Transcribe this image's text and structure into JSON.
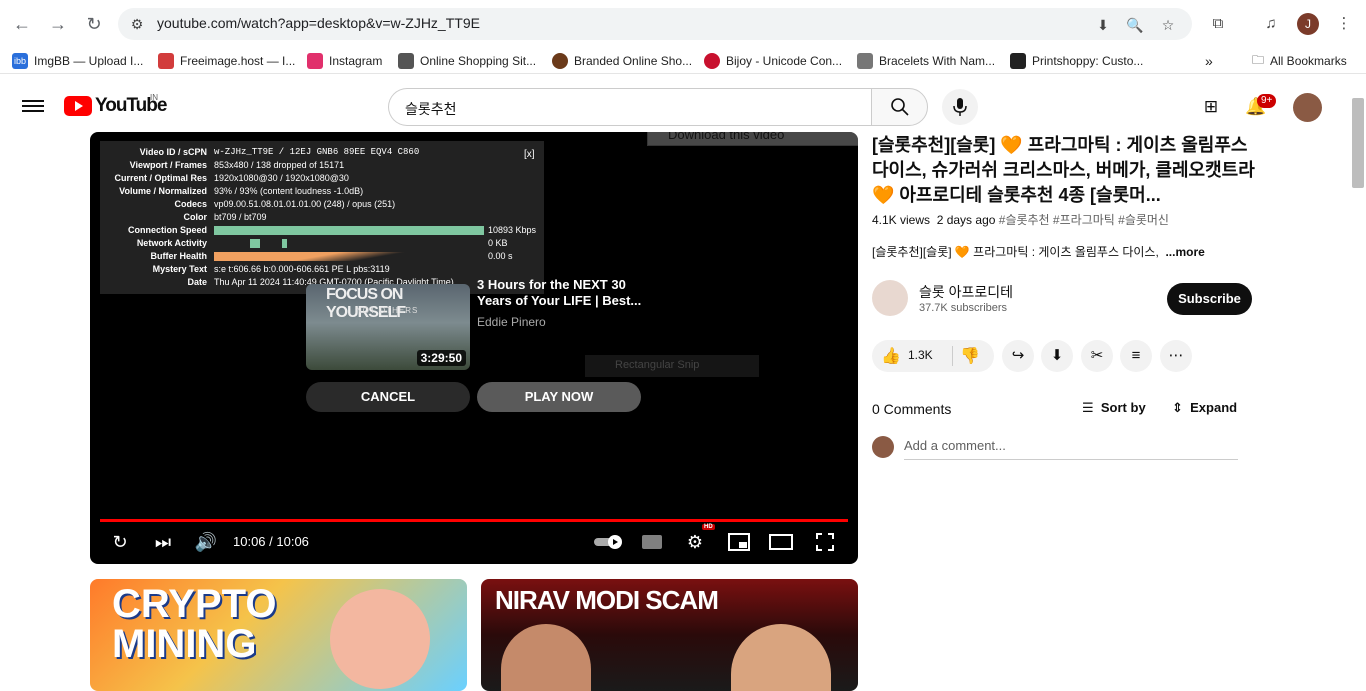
{
  "browser": {
    "url": "youtube.com/watch?app=desktop&v=w-ZJHz_TT9E",
    "profile_initial": "J",
    "bookmarks": [
      {
        "label": "ImgBB — Upload I...",
        "icon_color": "#2a6fdb"
      },
      {
        "label": "Freeimage.host — I...",
        "icon_color": "#d23c3c"
      },
      {
        "label": "Instagram",
        "icon_color": "#e1306c"
      },
      {
        "label": "Online Shopping Sit...",
        "icon_color": "#555555"
      },
      {
        "label": "Branded Online Sho...",
        "icon_color": "#6b3a1a"
      },
      {
        "label": "Bijoy - Unicode Con...",
        "icon_color": "#c8102e"
      },
      {
        "label": "Bracelets With Nam...",
        "icon_color": "#777777"
      },
      {
        "label": "Printshoppy: Custo...",
        "icon_color": "#222222"
      }
    ],
    "all_bookmarks": "All Bookmarks"
  },
  "youtube": {
    "logo_text": "YouTube",
    "region": "IN",
    "search_value": "슬롯추천",
    "notif_count": "9+"
  },
  "player": {
    "stats": [
      {
        "label": "Video ID / sCPN",
        "value": "w-ZJHz_TT9E / 12EJ GNB6 89EE EQV4 C860"
      },
      {
        "label": "Viewport / Frames",
        "value": "853x480 / 138 dropped of 15171"
      },
      {
        "label": "Current / Optimal Res",
        "value": "1920x1080@30 / 1920x1080@30"
      },
      {
        "label": "Volume / Normalized",
        "value": "93% / 93% (content loudness -1.0dB)"
      },
      {
        "label": "Codecs",
        "value": "vp09.00.51.08.01.01.01.00 (248) / opus (251)"
      },
      {
        "label": "Color",
        "value": "bt709 / bt709"
      },
      {
        "label": "Connection Speed",
        "value": "10893 Kbps"
      },
      {
        "label": "Network Activity",
        "value": "0 KB"
      },
      {
        "label": "Buffer Health",
        "value": "0.00 s"
      },
      {
        "label": "Mystery Text",
        "value": "s:e t:606.66 b:0.000-606.661 PE L pbs:3119"
      },
      {
        "label": "Date",
        "value": "Thu Apr 11 2024 11:40:49 GMT-0700 (Pacific Daylight Time)"
      }
    ],
    "stats_close": "[x]",
    "download_ext": "Download this video",
    "ghost_label": "Rectangular Snip",
    "endcard": {
      "thumb_title": "FOCUS ON YOURSELF",
      "thumb_sub": "NOT OTHERS",
      "duration": "3:29:50",
      "title": "3 Hours for the NEXT 30 Years of Your LIFE | Best...",
      "channel": "Eddie Pinero",
      "cancel": "CANCEL",
      "play": "PLAY NOW"
    },
    "time": "10:06 / 10:06",
    "progress": 1.0,
    "hd": "HD"
  },
  "video": {
    "title": "[슬롯추천][슬롯] 🧡 프라그마틱 : 게이츠 올림푸스 다이스, 슈가러쉬 크리스마스, 버메가, 클레오캣트라🧡 아프로디테 슬롯추천 4종 [슬롯머...",
    "views": "4.1K views",
    "age": "2 days ago",
    "tags": "#슬롯추천 #프라그마틱 #슬롯머신",
    "desc": "[슬롯추천][슬롯] 🧡 프라그마틱 : 게이츠 올림푸스 다이스,",
    "more": "...more",
    "channel": "슬롯 아프로디테",
    "subscribers": "37.7K subscribers",
    "subscribe": "Subscribe",
    "likes": "1.3K",
    "comments": "0 Comments",
    "sort": "Sort by",
    "expand": "Expand",
    "add_comment": "Add a comment..."
  },
  "recommendations": [
    {
      "thumb_text": "CRYPTO MINING"
    },
    {
      "thumb_text": "NIRAV MODI SCAM"
    }
  ]
}
